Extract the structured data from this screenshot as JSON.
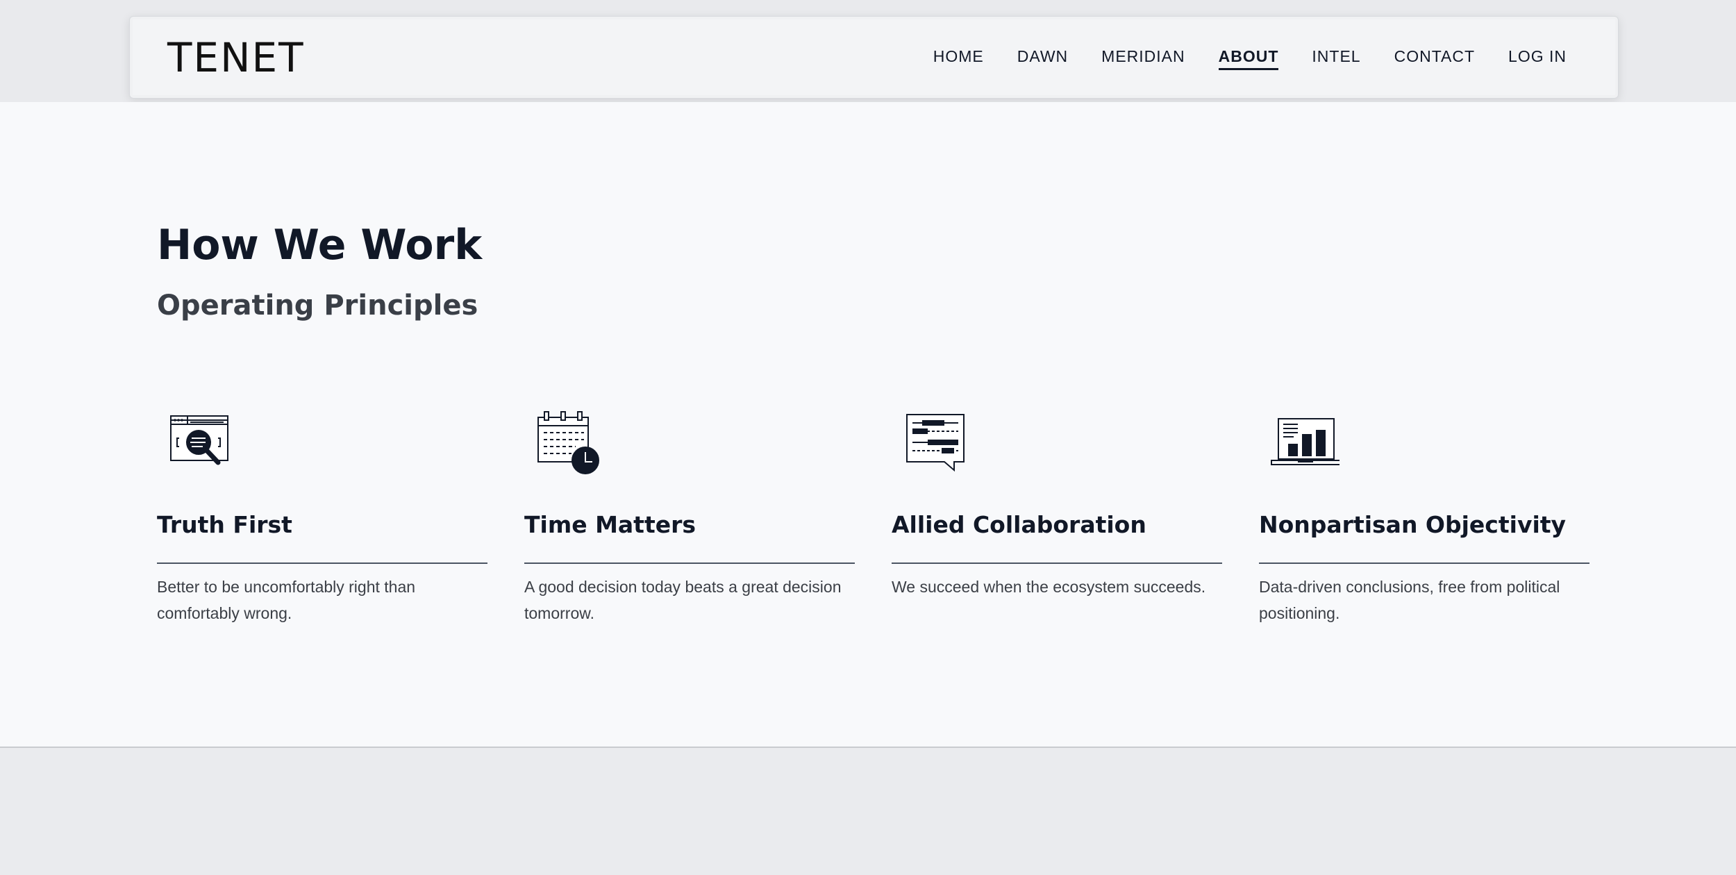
{
  "brand": {
    "logo_text": "TENET"
  },
  "nav": {
    "items": [
      {
        "label": "HOME",
        "active": false
      },
      {
        "label": "DAWN",
        "active": false
      },
      {
        "label": "MERIDIAN",
        "active": false
      },
      {
        "label": "ABOUT",
        "active": true
      },
      {
        "label": "INTEL",
        "active": false
      },
      {
        "label": "CONTACT",
        "active": false
      },
      {
        "label": "LOG IN",
        "active": false
      }
    ]
  },
  "section": {
    "title": "How We Work",
    "subtitle": "Operating Principles",
    "principles": [
      {
        "icon": "browser-search-icon",
        "title": "Truth First",
        "body": "Better to be uncomfortably right than comfortably wrong."
      },
      {
        "icon": "calendar-clock-icon",
        "title": "Time Matters",
        "body": "A good decision today beats a great decision tomorrow."
      },
      {
        "icon": "chat-timeline-icon",
        "title": "Allied Collaboration",
        "body": "We succeed when the ecosystem succeeds."
      },
      {
        "icon": "laptop-chart-icon",
        "title": "Nonpartisan Objectivity",
        "body": "Data-driven conclusions, free from political positioning."
      }
    ]
  },
  "colors": {
    "page_bg": "#eaebee",
    "section_bg": "#f8f9fb",
    "ink": "#111827",
    "muted_text": "#3b3f46"
  }
}
